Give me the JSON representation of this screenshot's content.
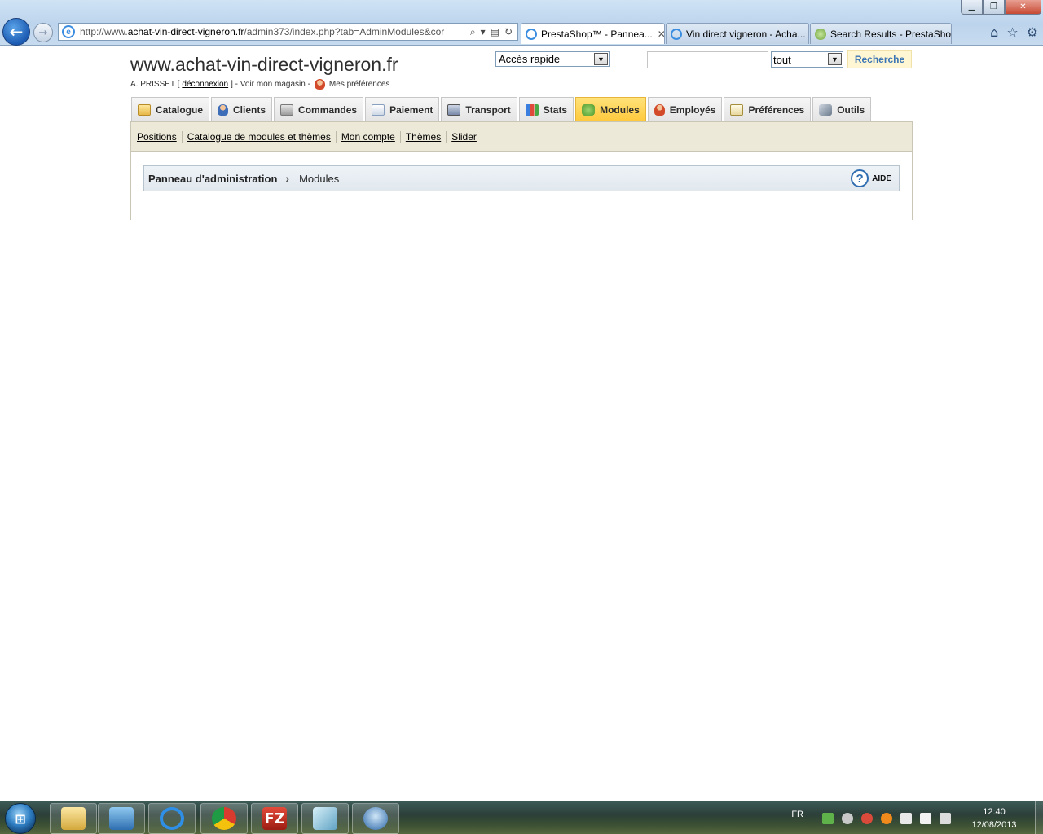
{
  "browser": {
    "url_prefix": "http://www.",
    "url_domain": "achat-vin-direct-vigneron.fr",
    "url_path": "/admin373/index.php?tab=AdminModules&cor",
    "tabs": [
      {
        "label": "PrestaShop™ - Pannea...",
        "active": true
      },
      {
        "label": "Vin direct vigneron - Acha...",
        "active": false
      },
      {
        "label": "Search Results - PrestaSho...",
        "active": false
      }
    ]
  },
  "header": {
    "site_title": "www.achat-vin-direct-vigneron.fr",
    "user_name": "A. PRISSET [",
    "logout_label": "déconnexion",
    "store_link": "] - Voir mon magasin -",
    "prefs_label": "Mes préférences",
    "quick_access": "Accès rapide",
    "search_scope": "tout",
    "search_button": "Recherche",
    "search_value": ""
  },
  "main_tabs": [
    {
      "label": "Catalogue"
    },
    {
      "label": "Clients"
    },
    {
      "label": "Commandes"
    },
    {
      "label": "Paiement"
    },
    {
      "label": "Transport"
    },
    {
      "label": "Stats"
    },
    {
      "label": "Modules"
    },
    {
      "label": "Employés"
    },
    {
      "label": "Préférences"
    },
    {
      "label": "Outils"
    }
  ],
  "active_tab": "Modules",
  "subnav": [
    "Positions",
    "Catalogue de modules et thèmes",
    "Mon compte",
    "Thèmes",
    "Slider"
  ],
  "breadcrumb": {
    "root": "Panneau d'administration",
    "current": "Modules",
    "help": "AIDE"
  },
  "taskbar": {
    "language": "FR",
    "time": "12:40",
    "date": "12/08/2013",
    "fz_label": "FZ"
  }
}
